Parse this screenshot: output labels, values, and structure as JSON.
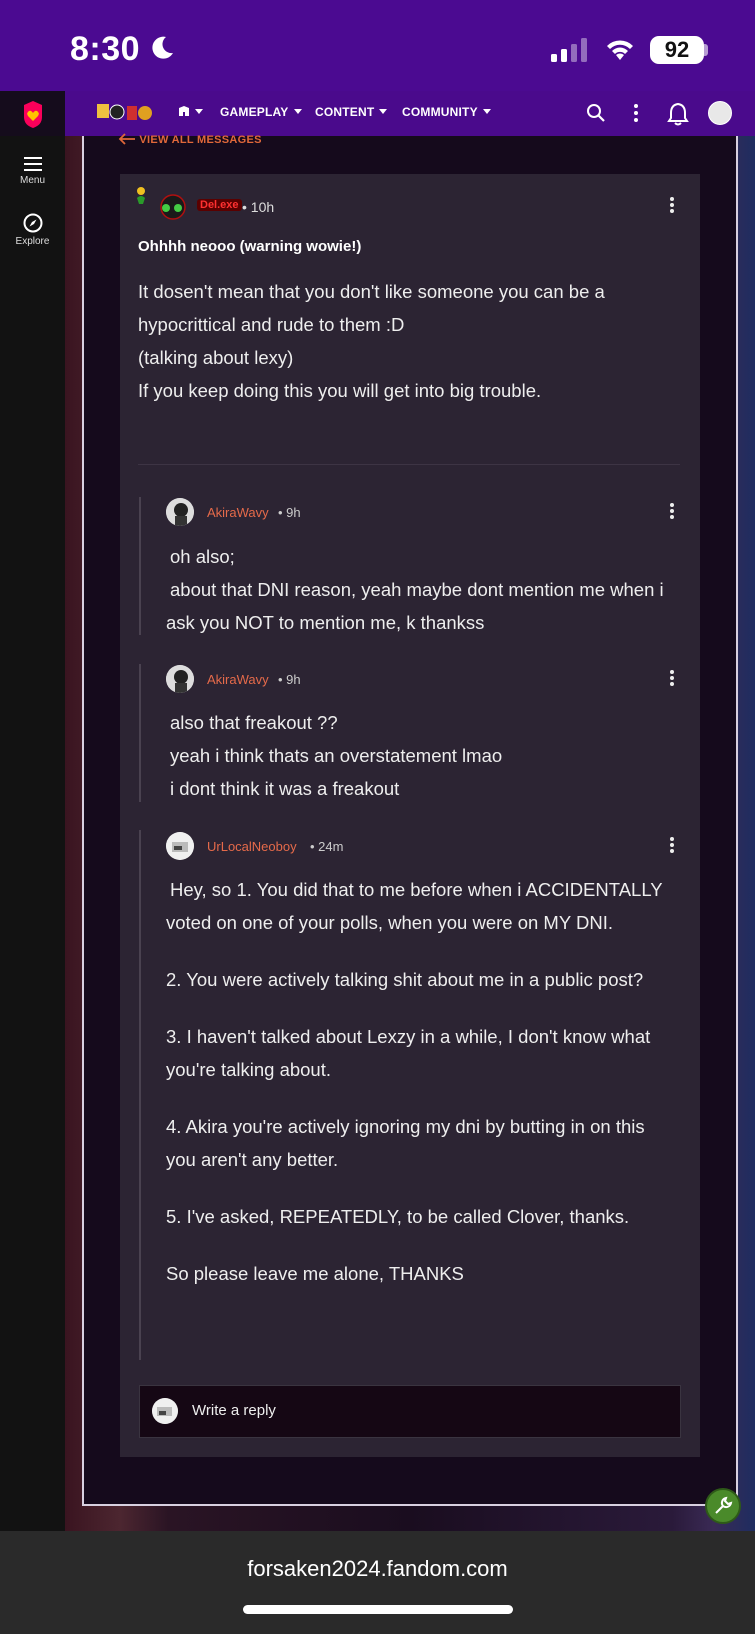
{
  "status_bar": {
    "time": "8:30",
    "battery": "92"
  },
  "nav": {
    "menu_items": [
      "GAMEPLAY",
      "CONTENT",
      "COMMUNITY"
    ]
  },
  "rail": {
    "menu_label": "Menu",
    "explore_label": "Explore"
  },
  "view_all": "VIEW ALL MESSAGES",
  "main_comment": {
    "username": "Del.exe",
    "time": "10h",
    "title": "Ohhhh neooo (warning wowie!)",
    "body": [
      "It dosen't mean that you don't like someone you can be a hypocrittical and rude to them :D",
      "(talking about lexy)",
      "If you keep doing this you will get into big trouble."
    ]
  },
  "replies": [
    {
      "username": "AkiraWavy",
      "time": "9h",
      "lines": [
        "oh also;",
        "about that DNI reason, yeah maybe dont mention me when i ask you NOT to mention me, k thankss"
      ]
    },
    {
      "username": "AkiraWavy",
      "time": "9h",
      "lines": [
        "also that freakout ??",
        "yeah i think thats an overstatement lmao",
        "i dont think it was a freakout"
      ]
    },
    {
      "username": "UrLocalNeoboy",
      "time": "24m",
      "paragraphs": [
        "Hey, so 1. You did that to me before when i ACCIDENTALLY voted on one of your polls, when you were on MY DNI.",
        "2. You were actively talking shit about me in a public post?",
        "3. I haven't talked about Lexzy in a while, I don't know what you're talking about.",
        "4. Akira you're actively ignoring my dni by butting in on this you aren't any better.",
        "5. I've asked, REPEATEDLY, to be called Clover, thanks.",
        "So please leave me alone, THANKS"
      ]
    }
  ],
  "write_reply": "Write a reply",
  "url": "forsaken2024.fandom.com",
  "colors": {
    "status_bar": "#4b0a91",
    "nav_bar": "#4a0a8c",
    "username": "#e56a4a",
    "card": "#2c2433"
  }
}
